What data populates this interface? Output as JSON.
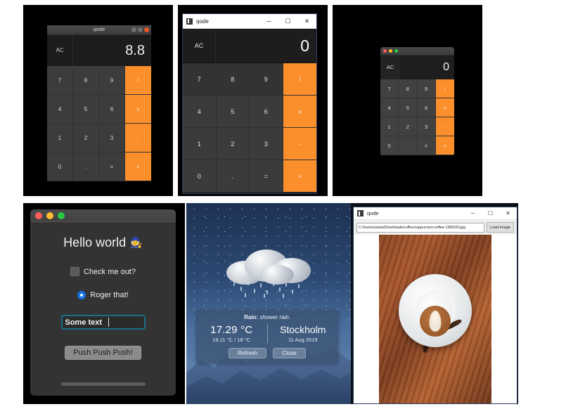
{
  "panels": {
    "linux_calculator": {
      "title": "qode",
      "window_buttons": [
        "minimize",
        "maximize",
        "close"
      ],
      "display": {
        "clear_label": "AC",
        "value": "8.8"
      },
      "keys": [
        "7",
        "8",
        "9",
        "/",
        "4",
        "5",
        "6",
        "x",
        "1",
        "2",
        "3",
        "-",
        "0",
        ".",
        "=",
        "+"
      ],
      "operator_keys": [
        "/",
        "x",
        "-",
        "+"
      ],
      "accent_color": "#fb8f2c"
    },
    "windows_calculator": {
      "title": "qode",
      "window_buttons": {
        "minimize": "─",
        "maximize": "☐",
        "close": "✕"
      },
      "display": {
        "clear_label": "AC",
        "value": "0"
      },
      "keys": [
        "7",
        "8",
        "9",
        "/",
        "4",
        "5",
        "6",
        "x",
        "1",
        "2",
        "3",
        "-",
        "0",
        ".",
        "=",
        "+"
      ],
      "accent_color": "#fb8f2c"
    },
    "mac_calculator": {
      "traffic_lights": [
        "close",
        "minimize",
        "zoom"
      ],
      "display": {
        "clear_label": "AC",
        "value": "0"
      },
      "keys": [
        "7",
        "8",
        "9",
        "/",
        "4",
        "5",
        "6",
        "x",
        "1",
        "2",
        "3",
        "-",
        "0",
        ".",
        "=",
        "+"
      ],
      "accent_color": "#fb8f2c"
    },
    "mac_form": {
      "traffic_lights": [
        "close",
        "minimize",
        "zoom"
      ],
      "heading": "Hello world",
      "heading_emoji": "🧙",
      "checkbox_label": "Check me out?",
      "checkbox_checked": false,
      "radio_label": "Roger that!",
      "radio_checked": true,
      "text_input_value": "Some text",
      "button_label": "Push Push Push!",
      "focus_color": "#1b6f86",
      "radio_color": "#1473e6"
    },
    "weather": {
      "condition_label": "Rain:",
      "condition_desc": "shower rain.",
      "temperature": "17.29 °C",
      "temperature_range": "16.11 °C / 18 °C",
      "city": "Stockholm",
      "date": "11 Aug 2019",
      "refresh_label": "Refresh",
      "close_label": "Close"
    },
    "image_viewer": {
      "title": "qode",
      "window_buttons": {
        "minimize": "─",
        "maximize": "☐",
        "close": "✕"
      },
      "path_value": "C:/Users/ustuta/Downloads/coffee/cappuccino-coffee-1390220.jpg",
      "load_button_label": "Load Image",
      "image_subject": "cappuccino latte art on wooden table"
    }
  }
}
